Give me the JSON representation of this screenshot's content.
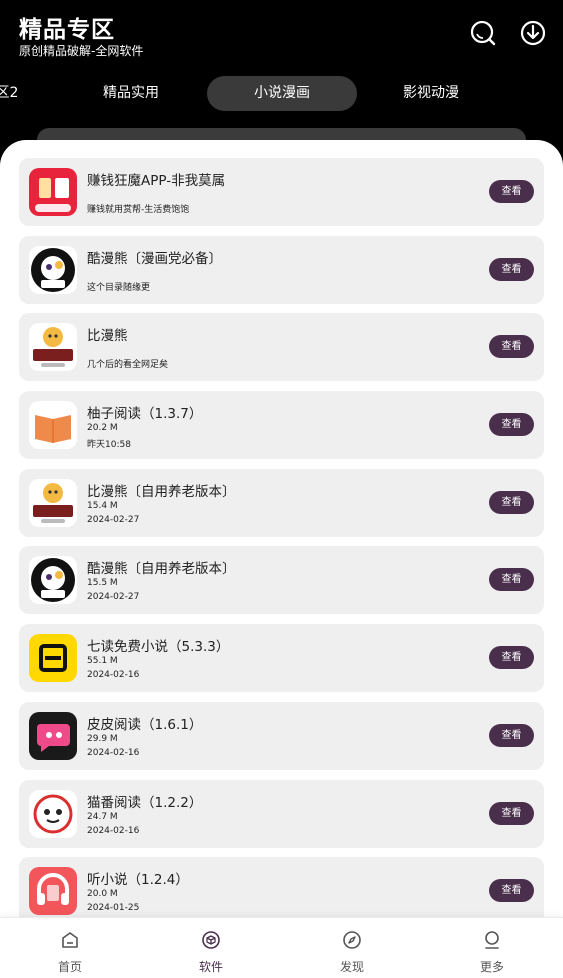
{
  "header": {
    "title": "精品专区",
    "subtitle": "原创精品破解-全网软件",
    "search_icon": "search-icon",
    "download_icon": "download-icon"
  },
  "tabs": [
    {
      "label": "区2",
      "active": false
    },
    {
      "label": "精品实用",
      "active": false
    },
    {
      "label": "小说漫画",
      "active": true
    },
    {
      "label": "影视动漫",
      "active": false
    }
  ],
  "view_label": "查看",
  "apps": [
    {
      "name": "赚钱狂魔APP-非我莫属",
      "desc": "赚钱就用赏帮-生活费饱饱",
      "icon": "shangbang-app-icon",
      "color": "#e8243c"
    },
    {
      "name": "酷漫熊〔漫画党必备〕",
      "desc": "这个目录随缘更",
      "icon": "kumanxiong-app-icon",
      "color": "#111111"
    },
    {
      "name": "比漫熊",
      "desc": "几个后的看全网足矣",
      "icon": "bimanxiong-app-icon",
      "color": "#7a1e1e"
    },
    {
      "name": "柚子阅读（1.3.7）",
      "size": "20.2 M",
      "date": "昨天10:58",
      "icon": "book-icon",
      "color": "#f08a4b"
    },
    {
      "name": "比漫熊〔自用养老版本〕",
      "size": "15.4 M",
      "date": "2024-02-27",
      "icon": "bimanxiong-app-icon",
      "color": "#7a1e1e"
    },
    {
      "name": "酷漫熊〔自用养老版本〕",
      "size": "15.5 M",
      "date": "2024-02-27",
      "icon": "kumanxiong-app-icon",
      "color": "#111111"
    },
    {
      "name": "七读免费小说（5.3.3）",
      "size": "55.1 M",
      "date": "2024-02-16",
      "icon": "qidu-app-icon",
      "color": "#ffd800"
    },
    {
      "name": "皮皮阅读（1.6.1）",
      "size": "29.9 M",
      "date": "2024-02-16",
      "icon": "chat-bubble-icon",
      "color": "#1a1a1a"
    },
    {
      "name": "猫番阅读（1.2.2）",
      "size": "24.7 M",
      "date": "2024-02-16",
      "icon": "cat-app-icon",
      "color": "#d9302f"
    },
    {
      "name": "听小说（1.2.4）",
      "size": "20.0 M",
      "date": "2024-01-25",
      "icon": "headphones-icon",
      "color": "#f2555a"
    }
  ],
  "bottom_nav": [
    {
      "label": "首页",
      "icon": "home-icon",
      "active": false
    },
    {
      "label": "软件",
      "icon": "cube-icon",
      "active": true
    },
    {
      "label": "发现",
      "icon": "compass-icon",
      "active": false
    },
    {
      "label": "更多",
      "icon": "user-icon",
      "active": false
    }
  ]
}
